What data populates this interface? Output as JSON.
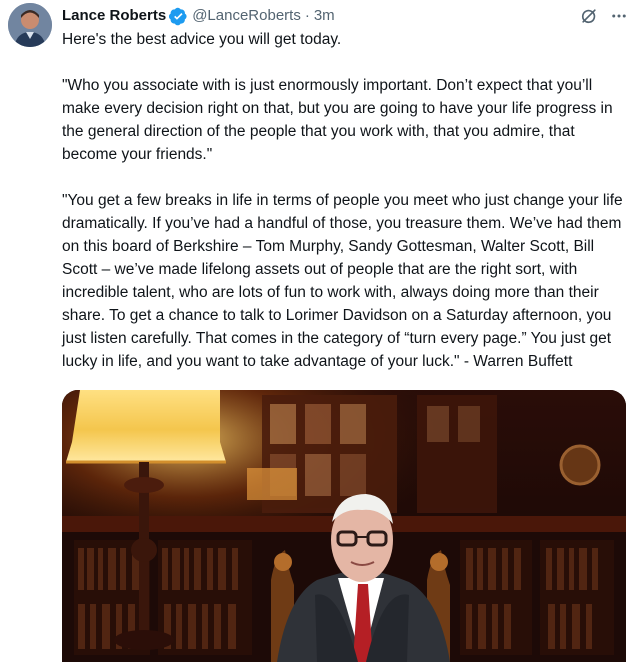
{
  "tweet": {
    "author_name": "Lance Roberts",
    "handle": "@LanceRoberts",
    "separator": "·",
    "time": "3m",
    "paragraphs": [
      "Here's the best advice you will get today.",
      "\"Who you associate with is just enormously important. Don’t expect that you’ll make every decision right on that, but you are going to have your life progress in the general direction of the people that you work with, that you admire, that become your friends.\"",
      "\"You get a few breaks in life in terms of people you meet who just change your life dramatically. If you’ve had a handful of those, you treasure them. We’ve had them on this board of Berkshire – Tom Murphy, Sandy Gottesman, Walter Scott, Bill Scott – we’ve made lifelong assets out of people that are the right sort, with incredible talent, who are lots of fun to work with, always doing more than their share. To get a chance to talk to Lorimer Davidson on a Saturday afternoon, you just listen carefully. That comes in the category of “turn every page.” You just get lucky in life, and you want to take advantage of your luck.\" - Warren Buffett"
    ]
  },
  "icons": {
    "verified": "verified-badge-icon",
    "grok": "grok-icon",
    "more": "more-options-icon"
  },
  "colors": {
    "verified_blue": "#1d9bf0",
    "secondary_text": "#536471",
    "primary_text": "#0f1419"
  }
}
